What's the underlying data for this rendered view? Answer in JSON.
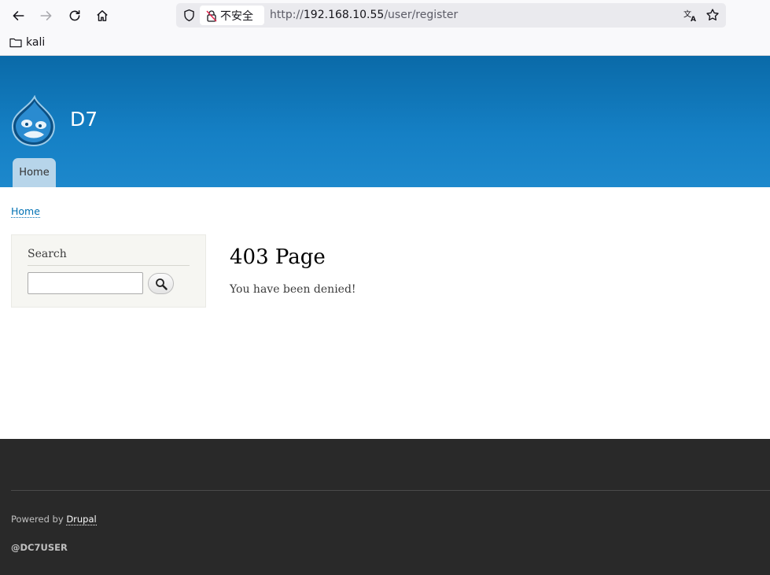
{
  "browser": {
    "back_icon": "arrow-left-icon",
    "forward_icon": "arrow-right-icon",
    "reload_icon": "reload-icon",
    "home_icon": "home-icon",
    "security_label": "不安全",
    "url_scheme": "http://",
    "url_host": "192.168.10.55",
    "url_path": "/user/register",
    "translate_icon": "translate-icon",
    "bookmark_star_icon": "star-icon",
    "bookmarks": [
      {
        "label": "kali",
        "icon": "folder-icon"
      }
    ]
  },
  "site": {
    "name": "D7",
    "logo": "drupal-drop-logo",
    "main_menu": [
      {
        "label": "Home",
        "active": true
      }
    ],
    "header_color": "#1580c5"
  },
  "breadcrumb": {
    "items": [
      "Home"
    ]
  },
  "sidebar": {
    "search_block": {
      "title": "Search",
      "input_value": "",
      "button_icon": "magnifier-icon"
    }
  },
  "content": {
    "title": "403 Page",
    "body": "You have been denied!"
  },
  "footer": {
    "powered_prefix": "Powered by ",
    "powered_link": "Drupal",
    "handle": "@DC7USER"
  }
}
